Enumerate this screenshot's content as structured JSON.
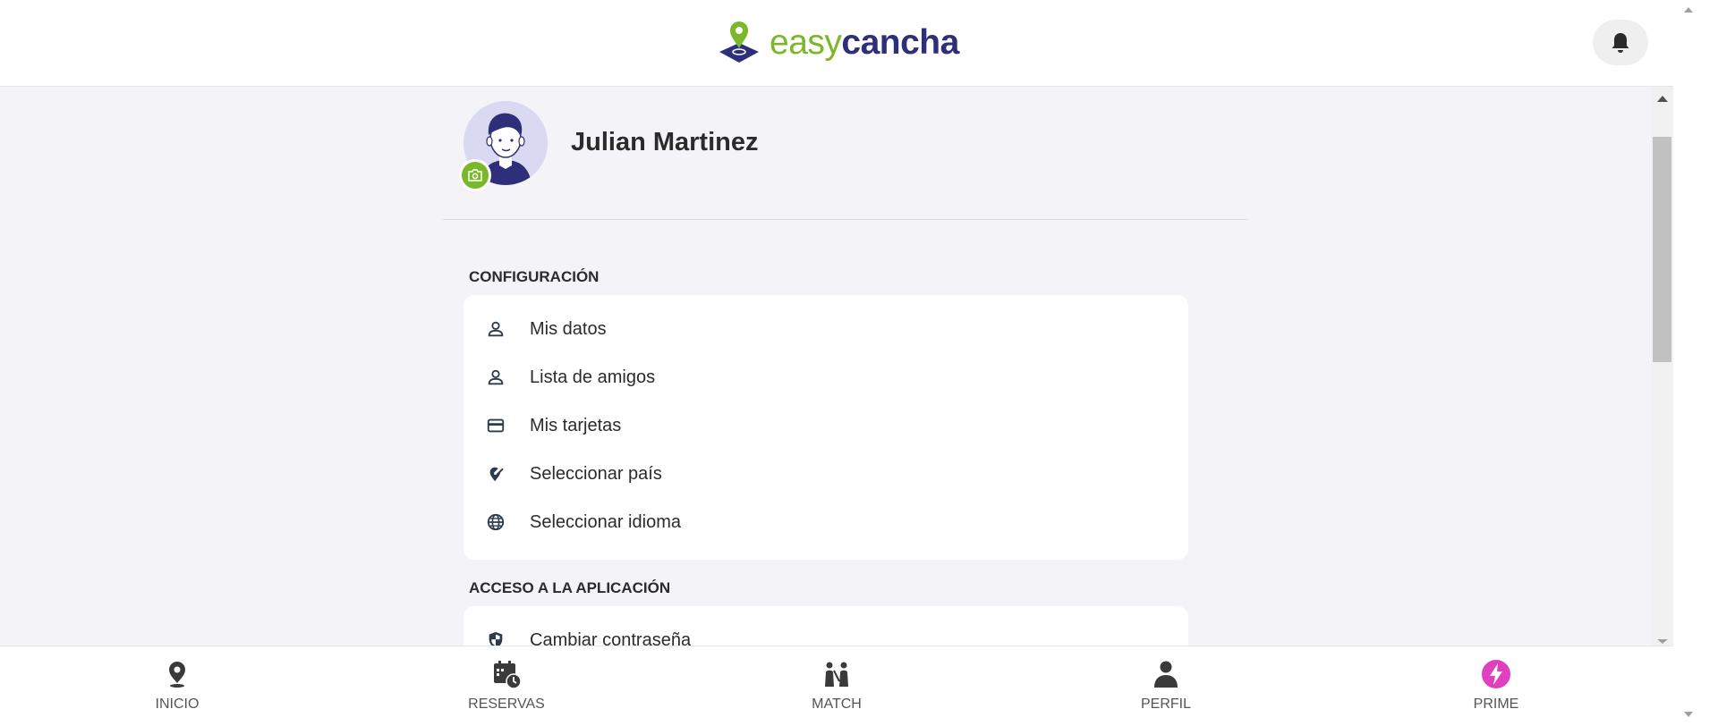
{
  "brand": {
    "logo_part1": "easy",
    "logo_part2": "cancha",
    "green": "#7ab829",
    "navy": "#2e2e7a"
  },
  "header": {
    "notification_icon": "bell-icon"
  },
  "profile": {
    "name": "Julian Martinez",
    "avatar_icon": "avatar-illustration",
    "badge_icon": "camera-icon"
  },
  "sections": [
    {
      "title": "CONFIGURACIÓN",
      "items": [
        {
          "label": "Mis datos",
          "icon": "person-icon"
        },
        {
          "label": "Lista de amigos",
          "icon": "person-icon"
        },
        {
          "label": "Mis tarjetas",
          "icon": "credit-card-icon"
        },
        {
          "label": "Seleccionar país",
          "icon": "location-edit-icon"
        },
        {
          "label": "Seleccionar idioma",
          "icon": "globe-icon"
        }
      ]
    },
    {
      "title": "ACCESO A LA APLICACIÓN",
      "items": [
        {
          "label": "Cambiar contraseña",
          "icon": "shield-icon"
        }
      ]
    }
  ],
  "bottom_nav": [
    {
      "label": "INICIO",
      "icon": "map-pin-icon"
    },
    {
      "label": "RESERVAS",
      "icon": "calendar-clock-icon"
    },
    {
      "label": "MATCH",
      "icon": "players-icon"
    },
    {
      "label": "PERFIL",
      "icon": "user-icon"
    },
    {
      "label": "PRIME",
      "icon": "lightning-icon",
      "color": "#e03fbf"
    }
  ]
}
